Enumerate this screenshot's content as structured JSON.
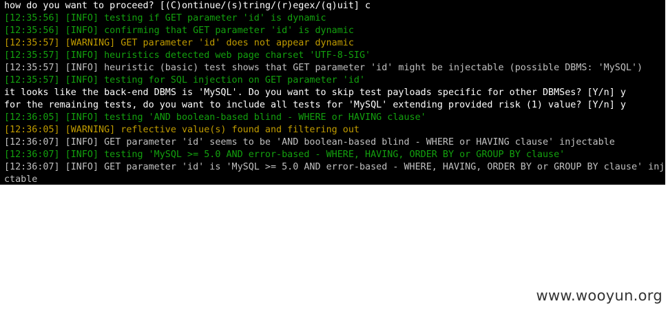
{
  "terminal": {
    "lines": [
      {
        "text": "how do you want to proceed? [(C)ontinue/(s)tring/(r)egex/(q)uit] c",
        "style": "prompt"
      },
      {
        "text": "[12:35:56] [INFO] testing if GET parameter 'id' is dynamic",
        "style": "dim"
      },
      {
        "text": "[12:35:56] [INFO] confirming that GET parameter 'id' is dynamic",
        "style": "dim"
      },
      {
        "text": "[12:35:57] [WARNING] GET parameter 'id' does not appear dynamic",
        "style": "warn"
      },
      {
        "text": "[12:35:57] [INFO] heuristics detected web page charset 'UTF-8-SIG'",
        "style": "dim"
      },
      {
        "text": "[12:35:57] [INFO] heuristic (basic) test shows that GET parameter 'id' might be injectable (possible DBMS: 'MySQL')",
        "style": "info"
      },
      {
        "text": "[12:35:57] [INFO] testing for SQL injection on GET parameter 'id'",
        "style": "dim"
      },
      {
        "text": "it looks like the back-end DBMS is 'MySQL'. Do you want to skip test payloads specific for other DBMSes? [Y/n] y",
        "style": "prompt"
      },
      {
        "text": "for the remaining tests, do you want to include all tests for 'MySQL' extending provided risk (1) value? [Y/n] y",
        "style": "prompt"
      },
      {
        "text": "[12:36:05] [INFO] testing 'AND boolean-based blind - WHERE or HAVING clause'",
        "style": "dim"
      },
      {
        "text": "[12:36:05] [WARNING] reflective value(s) found and filtering out",
        "style": "warn"
      },
      {
        "text": "[12:36:07] [INFO] GET parameter 'id' seems to be 'AND boolean-based blind - WHERE or HAVING clause' injectable",
        "style": "info"
      },
      {
        "text": "[12:36:07] [INFO] testing 'MySQL >= 5.0 AND error-based - WHERE, HAVING, ORDER BY or GROUP BY clause'",
        "style": "dim"
      },
      {
        "text": "[12:36:07] [INFO] GET parameter 'id' is 'MySQL >= 5.0 AND error-based - WHERE, HAVING, ORDER BY or GROUP BY clause' inje",
        "style": "info"
      },
      {
        "text": "ctable",
        "style": "info"
      }
    ]
  },
  "watermark": {
    "text": "www.wooyun.org"
  }
}
